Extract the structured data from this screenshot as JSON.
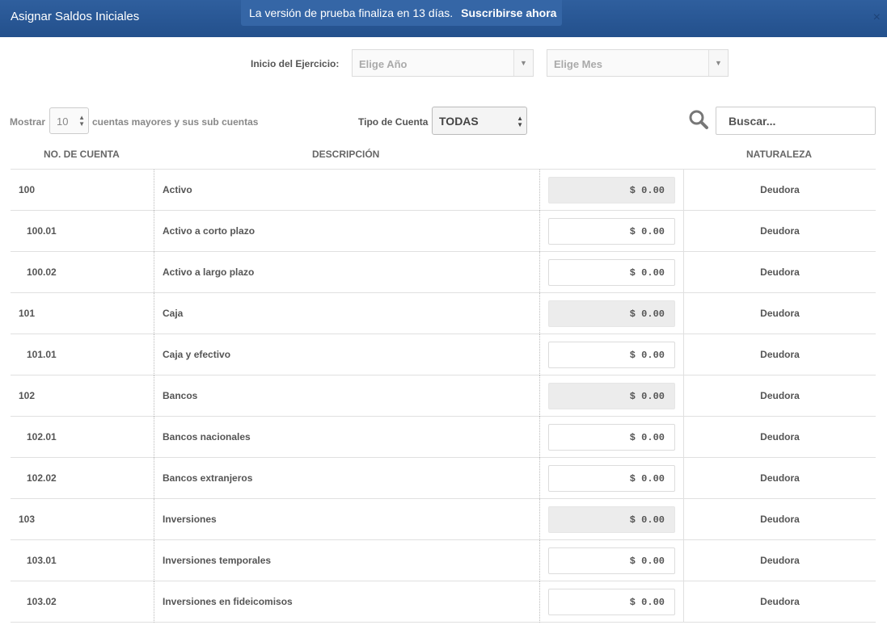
{
  "header": {
    "title": "Asignar Saldos Iniciales",
    "trial_text": "La versión de prueba finaliza en 13 días.",
    "trial_link": "Suscribirse ahora",
    "close_glyph": "×"
  },
  "period": {
    "label": "Inicio del Ejercicio:",
    "year_placeholder": "Elige Año",
    "month_placeholder": "Elige Mes"
  },
  "filters": {
    "show_label": "Mostrar",
    "page_size": "10",
    "page_size_suffix": "cuentas mayores y sus sub cuentas",
    "type_label": "Tipo de Cuenta",
    "type_value": "TODAS",
    "search_placeholder": "Buscar..."
  },
  "table": {
    "columns": [
      "NO. DE CUENTA",
      "DESCRIPCIÓN",
      "",
      "NATURALEZA"
    ],
    "rows": [
      {
        "number": "100",
        "description": "Activo",
        "amount": "$ 0.00",
        "nature": "Deudora",
        "level": "major"
      },
      {
        "number": "100.01",
        "description": "Activo a corto plazo",
        "amount": "$ 0.00",
        "nature": "Deudora",
        "level": "sub"
      },
      {
        "number": "100.02",
        "description": "Activo a largo plazo",
        "amount": "$ 0.00",
        "nature": "Deudora",
        "level": "sub"
      },
      {
        "number": "101",
        "description": "Caja",
        "amount": "$ 0.00",
        "nature": "Deudora",
        "level": "major"
      },
      {
        "number": "101.01",
        "description": "Caja y efectivo",
        "amount": "$ 0.00",
        "nature": "Deudora",
        "level": "sub"
      },
      {
        "number": "102",
        "description": "Bancos",
        "amount": "$ 0.00",
        "nature": "Deudora",
        "level": "major"
      },
      {
        "number": "102.01",
        "description": "Bancos nacionales",
        "amount": "$ 0.00",
        "nature": "Deudora",
        "level": "sub"
      },
      {
        "number": "102.02",
        "description": "Bancos extranjeros",
        "amount": "$ 0.00",
        "nature": "Deudora",
        "level": "sub"
      },
      {
        "number": "103",
        "description": "Inversiones",
        "amount": "$ 0.00",
        "nature": "Deudora",
        "level": "major"
      },
      {
        "number": "103.01",
        "description": "Inversiones temporales",
        "amount": "$ 0.00",
        "nature": "Deudora",
        "level": "sub"
      },
      {
        "number": "103.02",
        "description": "Inversiones en fideicomisos",
        "amount": "$ 0.00",
        "nature": "Deudora",
        "level": "sub"
      }
    ]
  },
  "colors": {
    "header_bg": "#2a5896",
    "banner_bg": "#3566a6",
    "readonly_amount_bg": "#ececec"
  },
  "icons": {
    "search": "search-icon",
    "close": "close-icon",
    "dropdown": "caret-down-icon",
    "spinner": "up-down-arrows-icon"
  }
}
